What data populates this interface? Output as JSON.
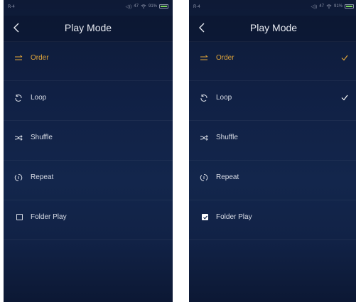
{
  "screens": [
    {
      "status": {
        "carrier": "R-4",
        "volume": "47",
        "battery": "91%"
      },
      "title": "Play Mode",
      "modes": [
        {
          "label": "Order",
          "icon": "order-icon",
          "active": true,
          "checked": false
        },
        {
          "label": "Loop",
          "icon": "loop-icon",
          "active": false,
          "checked": false
        },
        {
          "label": "Shuffle",
          "icon": "shuffle-icon",
          "active": false,
          "checked": false
        },
        {
          "label": "Repeat",
          "icon": "repeat-one-icon",
          "active": false,
          "checked": false
        }
      ],
      "folder_play": {
        "label": "Folder Play",
        "checked": false
      }
    },
    {
      "status": {
        "carrier": "R-4",
        "volume": "47",
        "battery": "91%"
      },
      "title": "Play Mode",
      "modes": [
        {
          "label": "Order",
          "icon": "order-icon",
          "active": true,
          "checked": true
        },
        {
          "label": "Loop",
          "icon": "loop-icon",
          "active": false,
          "checked": true
        },
        {
          "label": "Shuffle",
          "icon": "shuffle-icon",
          "active": false,
          "checked": false
        },
        {
          "label": "Repeat",
          "icon": "repeat-one-icon",
          "active": false,
          "checked": false
        }
      ],
      "folder_play": {
        "label": "Folder Play",
        "checked": true
      }
    }
  ],
  "colors": {
    "accent": "#e0a53a",
    "text": "#d9dde6",
    "background": "#102044"
  }
}
